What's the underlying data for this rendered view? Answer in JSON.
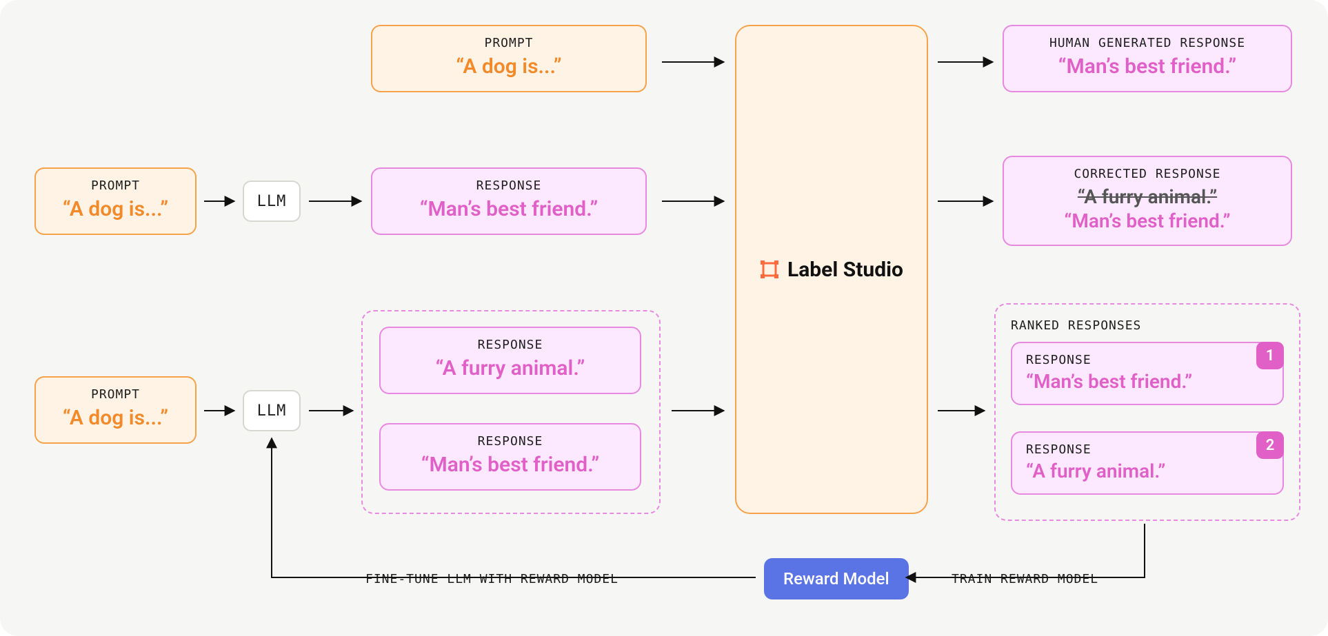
{
  "labels": {
    "prompt": "PROMPT",
    "response": "RESPONSE",
    "llm": "LLM",
    "human_generated": "HUMAN GENERATED RESPONSE",
    "corrected": "CORRECTED RESPONSE",
    "ranked": "RANKED RESPONSES",
    "label_studio": "Label Studio",
    "reward_model": "Reward Model",
    "finetune_caption": "FINE-TUNE LLM WITH REWARD MODEL",
    "train_caption": "TRAIN REWARD MODEL"
  },
  "strings": {
    "dog_prompt": "“A dog is...”",
    "best_friend": "“Man’s best friend.”",
    "furry": "“A furry animal.”"
  },
  "rank": {
    "first": "1",
    "second": "2"
  }
}
